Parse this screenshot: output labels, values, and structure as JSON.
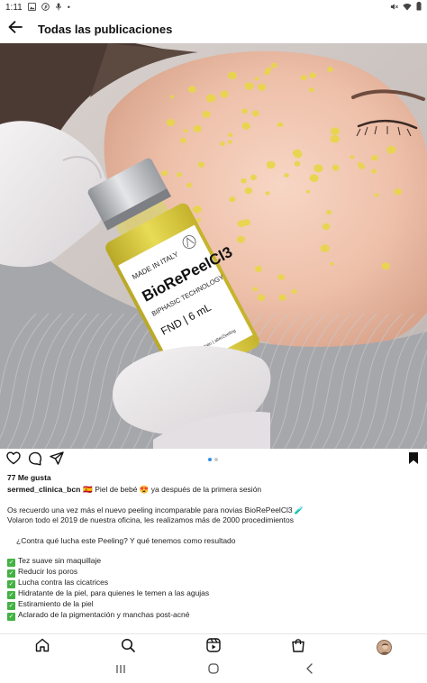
{
  "status_bar": {
    "time": "1:11",
    "left_icons": [
      "gallery-icon",
      "pinterest-icon",
      "mic-icon",
      "dot-icon"
    ],
    "right_icons": [
      "mute-icon",
      "wifi-icon",
      "battery-icon"
    ]
  },
  "app_bar": {
    "title": "Todas las publicaciones"
  },
  "post_image": {
    "vial_label": {
      "made_in": "MADE IN ITALY",
      "brand": "BioRePeelCl3",
      "subtitle": "BIPHASIC TECHNOLOGY",
      "volume": "FND | 6 mL",
      "footer": "Brevetto depositato | alterZeeling"
    }
  },
  "actions": {
    "icons": [
      "heart-icon",
      "comment-icon",
      "share-icon",
      "bookmark-icon"
    ],
    "carousel": {
      "count": 2,
      "active": 0
    }
  },
  "likes": "77 Me gusta",
  "caption": {
    "username": "sermed_clinica_bcn",
    "first_line": "🇪🇸 Piel de bebé 😍 ya después de la primera sesión",
    "lines": [
      "Os recuerdo una vez más el nuevo peeling incomparable para novias BioRePeelCl3 🧪",
      "Volaron todo el 2019 de nuestra oficina, les realizamos más de 2000 procedimientos"
    ],
    "question": "¿Contra qué lucha este Peeling? Y qué tenemos como resultado",
    "benefits": [
      "Tez suave sin maquillaje",
      "Reducir los poros",
      "Lucha contra las cicatrices",
      "Hidratante de la piel, para quienes le temen a las agujas",
      "Estiramiento de la piel",
      "Aclarado de la pigmentación y manchas post-acné"
    ]
  },
  "bottom_nav": {
    "icons": [
      "home-icon",
      "search-icon",
      "reels-icon",
      "shop-icon",
      "profile-avatar"
    ]
  },
  "system_nav": {
    "icons": [
      "recent-apps-icon",
      "home-circle-icon",
      "back-chevron-icon"
    ]
  },
  "colors": {
    "accent_blue": "#2f8fe8",
    "check_green": "#43b243",
    "serum_yellow": "#e8d64a",
    "skin": "#ecc2ad"
  }
}
